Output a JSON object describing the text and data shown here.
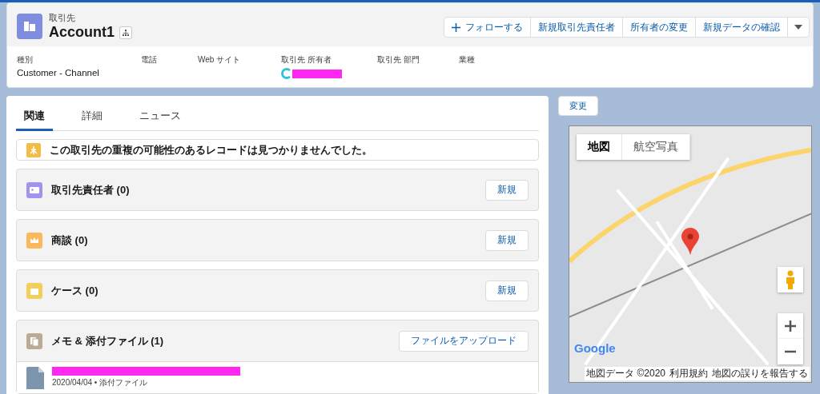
{
  "header": {
    "object_type": "取引先",
    "title": "Account1",
    "actions": [
      {
        "label": "フォローする",
        "kind": "follow"
      },
      {
        "label": "新規取引先責任者",
        "kind": "plain"
      },
      {
        "label": "所有者の変更",
        "kind": "plain"
      },
      {
        "label": "新規データの確認",
        "kind": "plain"
      }
    ],
    "fields": [
      {
        "label": "種別",
        "value": "Customer - Channel",
        "kind": "text"
      },
      {
        "label": "電話",
        "kind": "text"
      },
      {
        "label": "Web サイト",
        "kind": "text"
      },
      {
        "label": "取引先 所有者",
        "kind": "user"
      },
      {
        "label": "取引先 部門",
        "kind": "text"
      },
      {
        "label": "業種",
        "kind": "text"
      }
    ]
  },
  "tabs": [
    {
      "label": "関連",
      "selected": true
    },
    {
      "label": "詳細",
      "selected": false
    },
    {
      "label": "ニュース",
      "selected": false
    }
  ],
  "duplicate_notice": "この取引先の重複の可能性のあるレコードは見つかりませんでした。",
  "related_lists": [
    {
      "title": "取引先責任者 (0)",
      "kind": "contact",
      "button": "新規"
    },
    {
      "title": "商談 (0)",
      "kind": "opportunity",
      "button": "新規"
    },
    {
      "title": "ケース (0)",
      "kind": "case",
      "button": "新規"
    },
    {
      "title": "メモ & 添付ファイル (1)",
      "kind": "files",
      "button": "ファイルをアップロード"
    }
  ],
  "attachments": [
    {
      "meta": "2020/04/04 • 添付ファイル"
    }
  ],
  "change_button": "変更",
  "map": {
    "types": [
      {
        "label": "地図",
        "selected": true
      },
      {
        "label": "航空写真",
        "selected": false
      }
    ],
    "logo": "Google",
    "footer": [
      "地図データ ©2020",
      "利用規約",
      "地図の誤りを報告する"
    ]
  }
}
